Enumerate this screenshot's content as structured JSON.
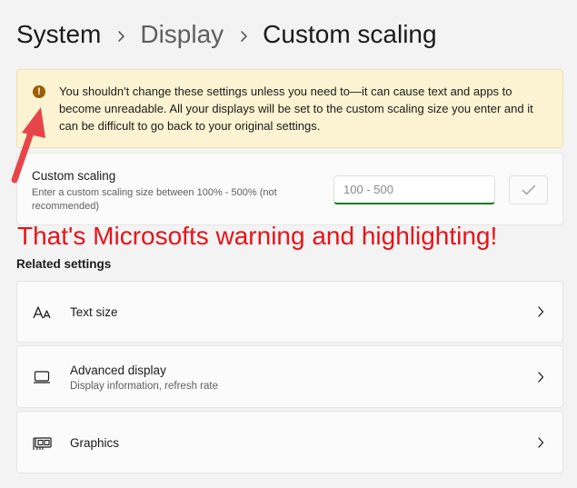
{
  "breadcrumb": {
    "root": "System",
    "parent": "Display",
    "current": "Custom scaling"
  },
  "warning": {
    "icon": "warning-icon",
    "text": "You shouldn't change these settings unless you need to—it can cause text and apps to become unreadable. All your displays will be set to the custom scaling size you enter and it can be difficult to go back to your original settings."
  },
  "custom_scaling": {
    "title": "Custom scaling",
    "description": "Enter a custom scaling size between 100% - 500% (not recommended)",
    "input_value": "",
    "input_placeholder": "100 - 500",
    "apply_icon": "checkmark-icon"
  },
  "annotation": {
    "text": "That's Microsofts warning and highlighting!",
    "color": "#e8131b"
  },
  "related": {
    "heading": "Related settings",
    "items": [
      {
        "label": "Text size",
        "subtitle": "",
        "icon": "text-size-icon"
      },
      {
        "label": "Advanced display",
        "subtitle": "Display information, refresh rate",
        "icon": "monitor-icon"
      },
      {
        "label": "Graphics",
        "subtitle": "",
        "icon": "graphics-card-icon"
      }
    ]
  },
  "colors": {
    "warning_background": "#fcf3d2",
    "warning_icon": "#9d5d00",
    "input_accent": "#0f7b0f",
    "page_background": "#f3f3f3"
  }
}
